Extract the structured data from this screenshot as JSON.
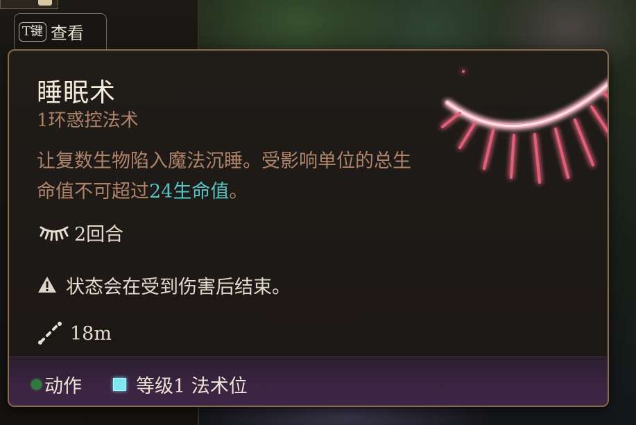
{
  "key_hint": {
    "key": "T键",
    "label": "查看"
  },
  "spell": {
    "name": "睡眠术",
    "school": "1环惑控法术",
    "description_before": "让复数生物陷入魔法沉睡。受影响单位的总生命值不可超过",
    "description_highlight": "24生命值",
    "description_after": "。",
    "duration": "2回合",
    "warning": "状态会在受到伤害后结束。",
    "range": "18m"
  },
  "footer": {
    "action_label": "动作",
    "slot_label": "等级1 法术位"
  },
  "colors": {
    "highlight": "#59c4c4",
    "body_text": "#b0846a",
    "border": "#8a6a4a",
    "action_dot": "#2f7a3e",
    "slot_square": "#7fe6f2",
    "spell_glow": "#e0607a"
  },
  "icons": {
    "spell_art": "sleep-closed-eye-icon",
    "duration": "closed-eye-icon",
    "warning": "warning-triangle-icon",
    "range": "range-icon"
  }
}
